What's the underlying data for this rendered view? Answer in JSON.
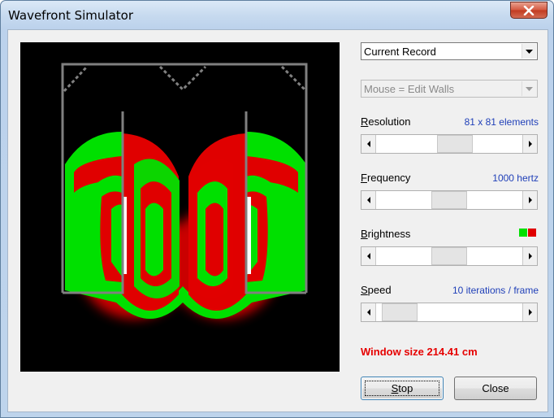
{
  "window": {
    "title": "Wavefront Simulator"
  },
  "view_select": {
    "value": "Current Record"
  },
  "mouse_select": {
    "value": "Mouse = Edit Walls"
  },
  "resolution": {
    "label_first": "R",
    "label_rest": "esolution",
    "value": "81 x 81 elements",
    "position": 0.55
  },
  "frequency": {
    "label_first": "F",
    "label_rest": "requency",
    "value": "1000 hertz",
    "position": 0.5
  },
  "brightness": {
    "label_first": "B",
    "label_rest": "rightness",
    "position": 0.5,
    "swatch_colors": [
      "#00e000",
      "#e00000"
    ]
  },
  "speed": {
    "label_first": "S",
    "label_rest": "peed",
    "value": "10 iterations / frame",
    "position": 0.05
  },
  "status": {
    "text": "Window size 214.41 cm",
    "color": "#e60000"
  },
  "buttons": {
    "stop_first": "S",
    "stop_rest": "top",
    "close": "Close"
  },
  "colors": {
    "wave_positive": "#00e000",
    "wave_negative": "#e00000",
    "wall": "#808080",
    "source": "#ffffff"
  }
}
